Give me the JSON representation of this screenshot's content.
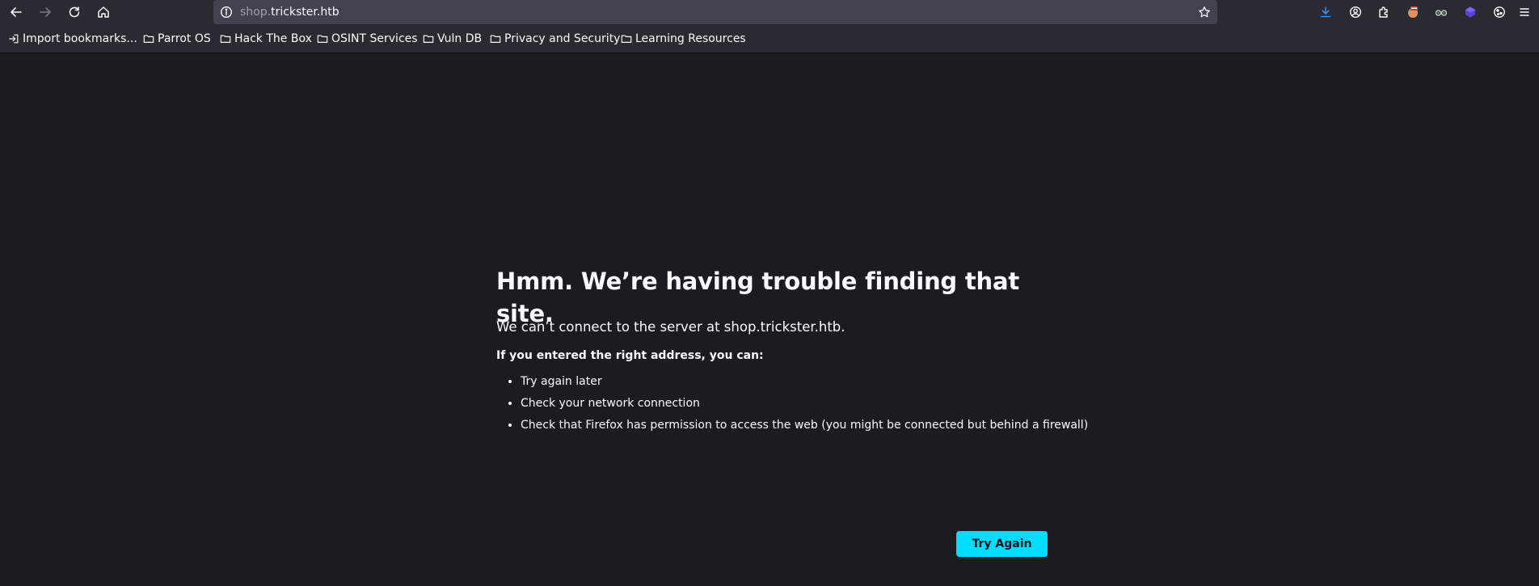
{
  "browser": {
    "url_subdomain": "shop.",
    "url_domain": "trickster.htb",
    "icons": {
      "back": "back-arrow-icon",
      "forward": "forward-arrow-icon",
      "reload": "reload-icon",
      "home": "home-icon",
      "info": "info-icon",
      "bookmark_star": "star-icon",
      "downloads": "download-icon",
      "account": "account-icon",
      "extensions": "puzzle-icon",
      "menu": "hamburger-menu-icon"
    },
    "colors": {
      "toolbar": "#2b2a33",
      "urlbar": "#42414d",
      "page_bg": "#1c1b22",
      "accent": "#00ddff",
      "download_blue": "#3a8ee6"
    }
  },
  "bookmarks": [
    {
      "label": "Import bookmarks...",
      "icon": "import-icon"
    },
    {
      "label": "Parrot OS",
      "icon": "folder-icon"
    },
    {
      "label": "Hack The Box",
      "icon": "folder-icon"
    },
    {
      "label": "OSINT Services",
      "icon": "folder-icon"
    },
    {
      "label": "Vuln DB",
      "icon": "folder-icon"
    },
    {
      "label": "Privacy and Security",
      "icon": "folder-icon"
    },
    {
      "label": "Learning Resources",
      "icon": "folder-icon"
    }
  ],
  "error_page": {
    "title": "Hmm. We’re having trouble finding that site.",
    "description": "We can’t connect to the server at shop.trickster.htb.",
    "subheading": "If you entered the right address, you can:",
    "suggestions": [
      "Try again later",
      "Check your network connection",
      "Check that Firefox has permission to access the web (you might be connected but behind a firewall)"
    ],
    "button_label": "Try Again"
  }
}
